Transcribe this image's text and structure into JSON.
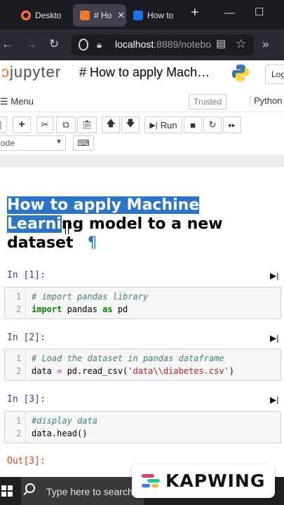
{
  "browser": {
    "tabs": [
      {
        "label": "Deskto",
        "icon": "firefox-icon",
        "active": false
      },
      {
        "label": "# Ho",
        "icon": "jupyter-book-icon",
        "active": true
      },
      {
        "label": "How to",
        "icon": "edit-icon",
        "active": false
      }
    ],
    "new_tab": "+",
    "url_host": "localhost",
    "url_rest": ":8889/notebo"
  },
  "jupyter": {
    "logo_text": "jupyter",
    "notebook_title": "# How to apply Mach…",
    "logout_label": "Log",
    "menu_label": "Menu",
    "trusted_label": "Trusted",
    "kernel_label": "Python",
    "run_label": "Run",
    "cell_type": "ode"
  },
  "heading": {
    "selected_part1": "How to apply Machine",
    "selected_part2": "Learni",
    "rest_line2": "ng model to a new",
    "line3": "dataset",
    "pilcrow": "¶"
  },
  "cells": [
    {
      "prompt": "In [1]:",
      "lines": [
        {
          "num": "1",
          "comment": "# import pandas library"
        },
        {
          "num": "2",
          "kw1": "import",
          "mid": " pandas ",
          "kw2": "as",
          "end": " pd"
        }
      ]
    },
    {
      "prompt": "In [2]:",
      "lines": [
        {
          "num": "1",
          "comment": "# Load the dataset in pandas dataframe"
        },
        {
          "num": "2",
          "pre": "data ",
          "op": "=",
          "mid": " pd.read_csv(",
          "str": "'data\\\\diabetes.csv'",
          "end": ")"
        }
      ]
    },
    {
      "prompt": "In [3]:",
      "lines": [
        {
          "num": "1",
          "comment": "#display data"
        },
        {
          "num": "2",
          "code": "data.head()"
        }
      ]
    }
  ],
  "out_prompt": "Out[3]:",
  "taskbar": {
    "search_placeholder": "Type here to search"
  },
  "watermark": {
    "text": "KAPWING",
    "colors": [
      "#e23d6d",
      "#23c5a8",
      "#3f7be6",
      "#f5b62d"
    ]
  },
  "colors": {
    "selection": "#2a74c9",
    "jupyter_orange": "#f37726",
    "prompt_in": "#303f9f",
    "prompt_out": "#d84315"
  }
}
